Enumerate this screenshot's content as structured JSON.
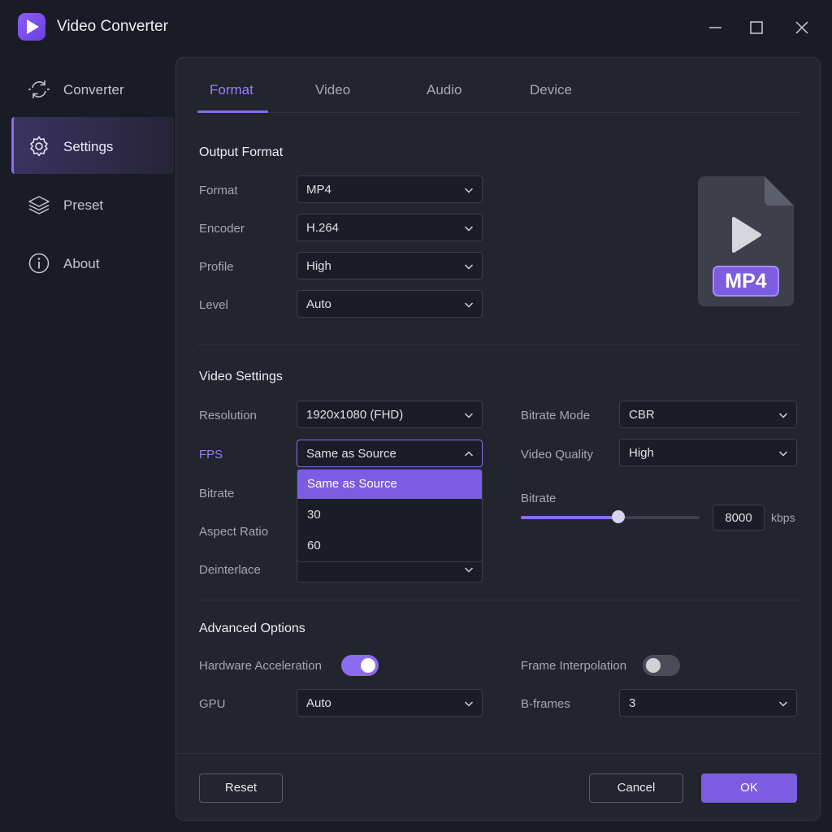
{
  "window": {
    "title": "Video Converter"
  },
  "sidebar": {
    "items": [
      {
        "label": "Converter",
        "icon": "converter-icon"
      },
      {
        "label": "Settings",
        "icon": "gear-icon",
        "active": true
      },
      {
        "label": "Preset",
        "icon": "layers-icon"
      },
      {
        "label": "About",
        "icon": "info-icon"
      }
    ]
  },
  "tabs": [
    {
      "label": "Format",
      "active": true
    },
    {
      "label": "Video"
    },
    {
      "label": "Audio"
    },
    {
      "label": "Device"
    }
  ],
  "output_format": {
    "title": "Output Format",
    "format": {
      "label": "Format",
      "value": "MP4"
    },
    "encoder": {
      "label": "Encoder",
      "value": "H.264"
    },
    "profile": {
      "label": "Profile",
      "value": "High"
    },
    "level": {
      "label": "Level",
      "value": "Auto"
    },
    "file_badge": "MP4"
  },
  "video_settings": {
    "title": "Video Settings",
    "resolution": {
      "label": "Resolution",
      "value": "1920x1080 (FHD)"
    },
    "fps": {
      "label": "FPS",
      "value": "Same as Source",
      "options": [
        "Same as Source",
        "30",
        "60"
      ]
    },
    "bitrate_label": "Bitrate",
    "aspect_ratio_label": "Aspect Ratio",
    "deinterlace_label": "Deinterlace",
    "bitrate_mode": {
      "label": "Bitrate Mode",
      "value": "CBR"
    },
    "video_quality": {
      "label": "Video Quality",
      "value": "High"
    },
    "bitrate_slider": {
      "label": "Bitrate",
      "value": "8000",
      "unit": "kbps",
      "fraction": 0.545
    }
  },
  "advanced": {
    "title": "Advanced Options",
    "hardware_acceleration": {
      "label": "Hardware Acceleration",
      "on": true
    },
    "frame_interpolation": {
      "label": "Frame Interpolation",
      "on": false
    },
    "gpu": {
      "label": "GPU",
      "value": "Auto"
    },
    "bframes": {
      "label": "B-frames",
      "value": "3"
    }
  },
  "footer": {
    "reset": "Reset",
    "cancel": "Cancel",
    "ok": "OK"
  },
  "colors": {
    "accent": "#8b6cf0",
    "background": "#1a1c25",
    "panel": "#22242e"
  }
}
